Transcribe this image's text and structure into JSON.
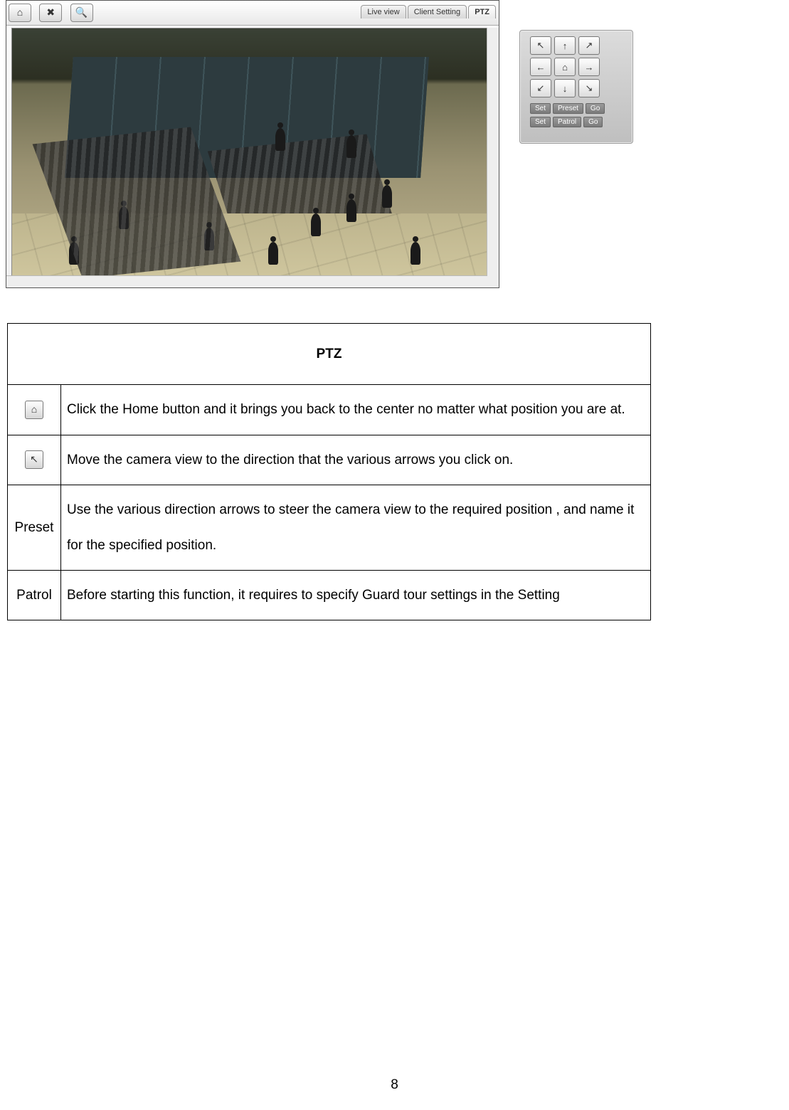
{
  "toolbar": {
    "home_icon": "⌂",
    "tools_icon": "✖",
    "search_icon": "🔍"
  },
  "tabs": {
    "live_view": "Live view",
    "client_setting": "Client Setting",
    "ptz": "PTZ"
  },
  "ptz_pad": {
    "nw": "↖",
    "n": "↑",
    "ne": "↗",
    "w": "←",
    "home": "⌂",
    "e": "→",
    "sw": "↙",
    "s": "↓",
    "se": "↘",
    "set": "Set",
    "preset": "Preset",
    "patrol": "Patrol",
    "go": "Go"
  },
  "table": {
    "title": "PTZ",
    "rows": [
      {
        "label_icon": "⌂",
        "desc": "Click the Home button and it brings you back to the center no matter what position you are at."
      },
      {
        "label_icon": "↖",
        "desc": "Move the camera view to the direction that the various arrows you click on."
      },
      {
        "label_text": "Preset",
        "desc": "Use the various direction arrows to steer the camera view to the required position , and name  it for the specified position."
      },
      {
        "label_text": "Patrol",
        "desc": "Before starting this function, it requires to specify Guard tour settings in the Setting"
      }
    ]
  },
  "page_number": "8"
}
